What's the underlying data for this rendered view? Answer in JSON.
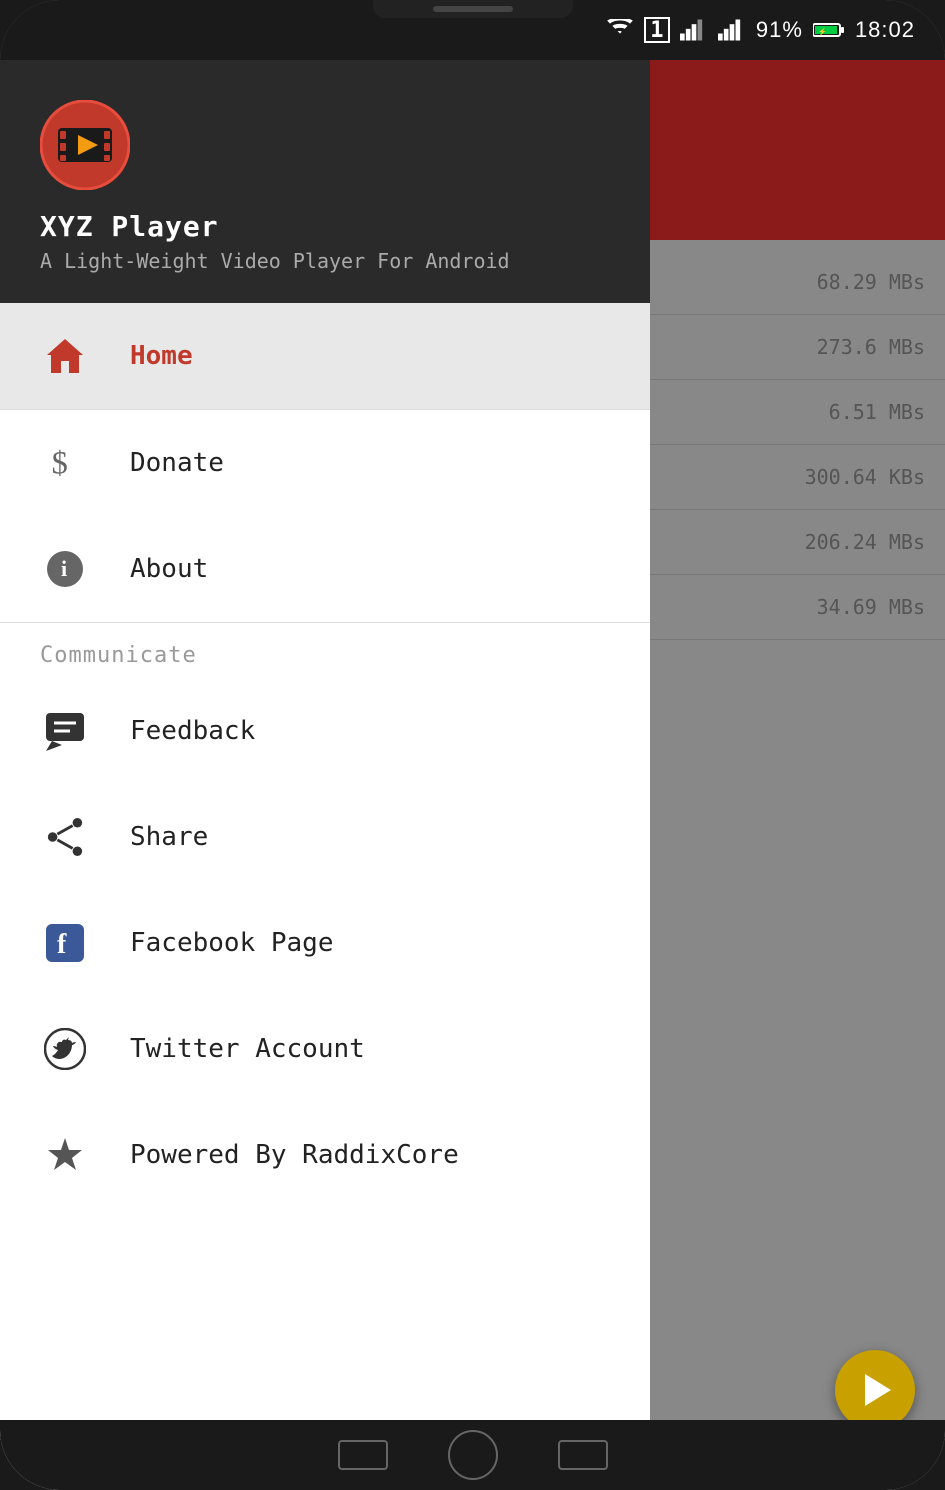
{
  "status_bar": {
    "battery": "91%",
    "time": "18:02",
    "wifi_icon": "wifi",
    "signal_icon": "signal"
  },
  "app": {
    "name": "XYZ Player",
    "subtitle": "A Light-Weight Video Player For Android",
    "logo_alt": "XYZ Player Logo"
  },
  "menu_items": [
    {
      "id": "home",
      "label": "Home",
      "icon": "home",
      "active": true
    },
    {
      "id": "donate",
      "label": "Donate",
      "icon": "dollar",
      "active": false
    },
    {
      "id": "about",
      "label": "About",
      "icon": "info",
      "active": false
    }
  ],
  "communicate_section": {
    "title": "Communicate",
    "items": [
      {
        "id": "feedback",
        "label": "Feedback",
        "icon": "feedback"
      },
      {
        "id": "share",
        "label": "Share",
        "icon": "share"
      },
      {
        "id": "facebook",
        "label": "Facebook Page",
        "icon": "facebook"
      },
      {
        "id": "twitter",
        "label": "Twitter Account",
        "icon": "twitter"
      },
      {
        "id": "powered",
        "label": "Powered By RaddixCore",
        "icon": "star"
      }
    ]
  },
  "file_sizes": [
    "68.29 MBs",
    "273.6 MBs",
    "6.51 MBs",
    "300.64 KBs",
    "206.24 MBs",
    "34.69 MBs"
  ]
}
